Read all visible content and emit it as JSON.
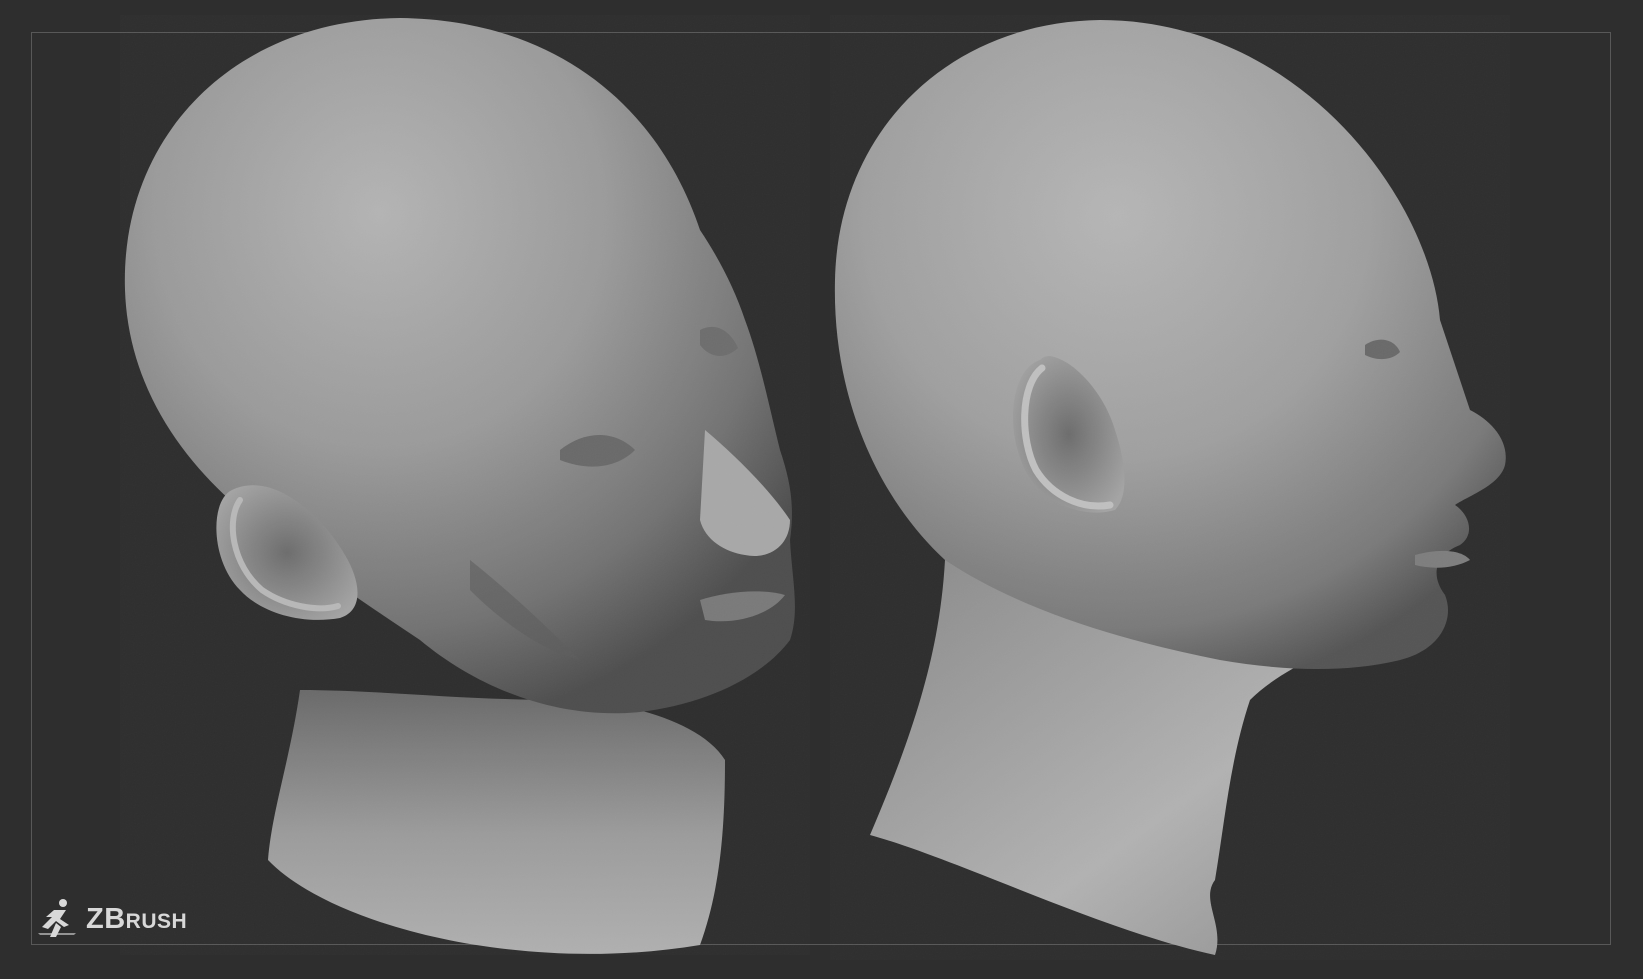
{
  "app": {
    "brand_initials": "ZB",
    "brand_rest": "RUSH",
    "logo_icon": "zbrush-running-figure-icon"
  },
  "scene": {
    "background_color": "#2e2e2e",
    "frame_color": "#585858",
    "clay_color": "#9a9a9a",
    "models": [
      "three-quarter-head-view",
      "profile-head-view"
    ]
  }
}
